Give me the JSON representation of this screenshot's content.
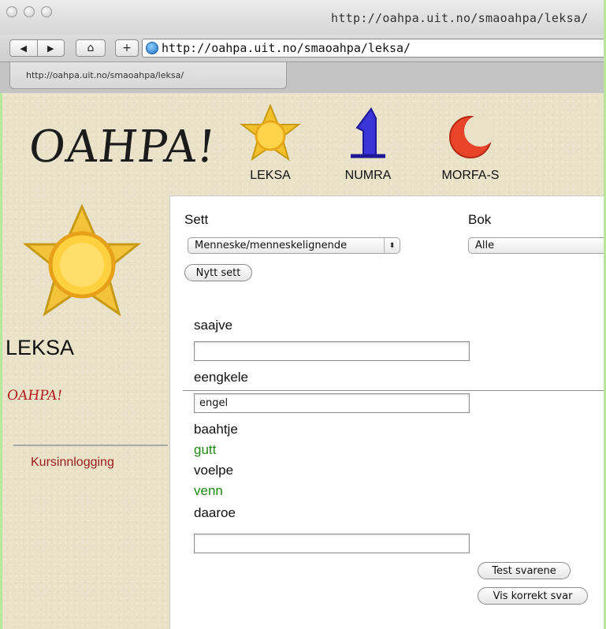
{
  "browser": {
    "window_title": "http://oahpa.uit.no/smaoahpa/leksa/",
    "url": "http://oahpa.uit.no/smaoahpa/leksa/",
    "tab_title": "http://oahpa.uit.no/smaoahpa/leksa/",
    "back_glyph": "◀",
    "forward_glyph": "▶",
    "home_glyph": "⌂",
    "add_glyph": "+"
  },
  "header": {
    "logo": "OAHPA!",
    "nav": [
      {
        "label": "LEKSA",
        "icon": "sun-star-icon"
      },
      {
        "label": "NUMRA",
        "icon": "blue-number-icon"
      },
      {
        "label": "MORFA-S",
        "icon": "red-moon-icon"
      }
    ]
  },
  "sidebar": {
    "title": "LEKSA",
    "mini_logo": "OAHPA!",
    "link": "Kursinnlogging"
  },
  "form": {
    "sett_label": "Sett",
    "sett_value": "Menneske/menneskelignende",
    "bok_label": "Bok",
    "bok_value": "Alle",
    "new_set_button": "Nytt sett",
    "select_arrows": "⬍",
    "questions": [
      {
        "word": "saajve",
        "type": "input",
        "value": ""
      },
      {
        "word": "eengkele",
        "type": "input",
        "value": "engel"
      },
      {
        "word": "baahtje",
        "type": "answer",
        "answer": "gutt"
      },
      {
        "word": "voelpe",
        "type": "answer",
        "answer": "venn"
      },
      {
        "word": "daaroe",
        "type": "input",
        "value": ""
      }
    ],
    "test_button": "Test svarene",
    "show_button": "Vis korrekt svar"
  },
  "colors": {
    "answer_green": "#1f8a12",
    "link_red": "#9c1b1b",
    "page_bg": "#e9e1c8"
  }
}
